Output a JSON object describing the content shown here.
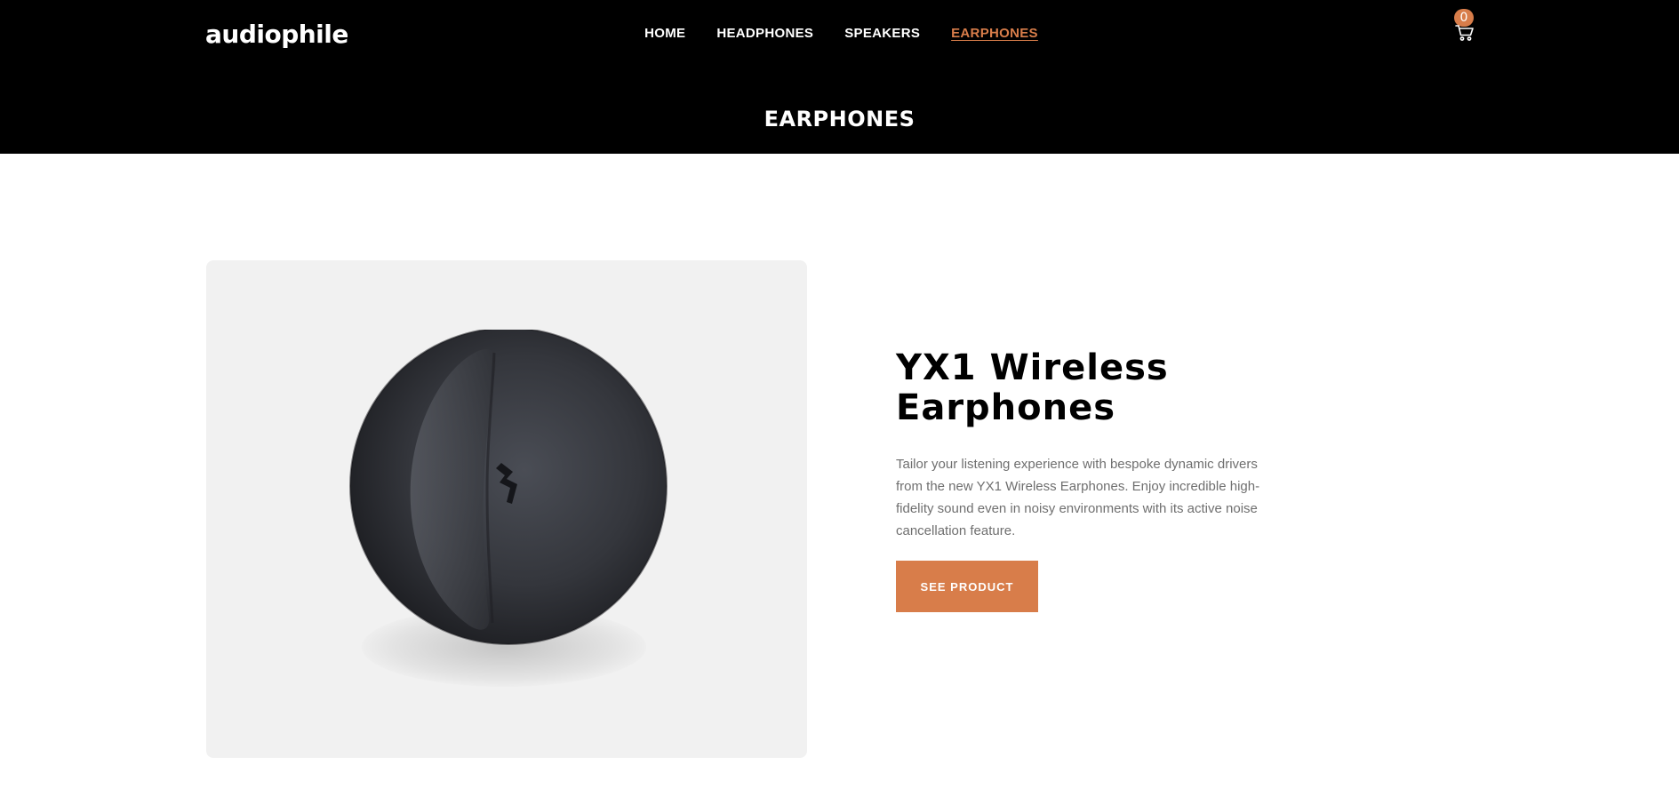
{
  "header": {
    "logo": "audiophile",
    "nav": [
      {
        "label": "HOME",
        "active": false
      },
      {
        "label": "HEADPHONES",
        "active": false
      },
      {
        "label": "SPEAKERS",
        "active": false
      },
      {
        "label": "EARPHONES",
        "active": true
      }
    ],
    "cart": {
      "count": "0",
      "icon": "cart-icon"
    },
    "page_title": "EARPHONES"
  },
  "product": {
    "image_icon": "earphone-image",
    "title_line1": "YX1 Wireless",
    "title_line2": "Earphones",
    "description": "Tailor your listening experience with bespoke dynamic drivers from the new YX1 Wireless Earphones. Enjoy incredible high-fidelity sound even in noisy environments with its active noise cancellation feature.",
    "cta_label": "SEE PRODUCT"
  },
  "colors": {
    "accent": "#d87d4a",
    "header_bg": "#000000",
    "card_bg": "#f1f1f1",
    "body_text": "#6f6f6f"
  }
}
